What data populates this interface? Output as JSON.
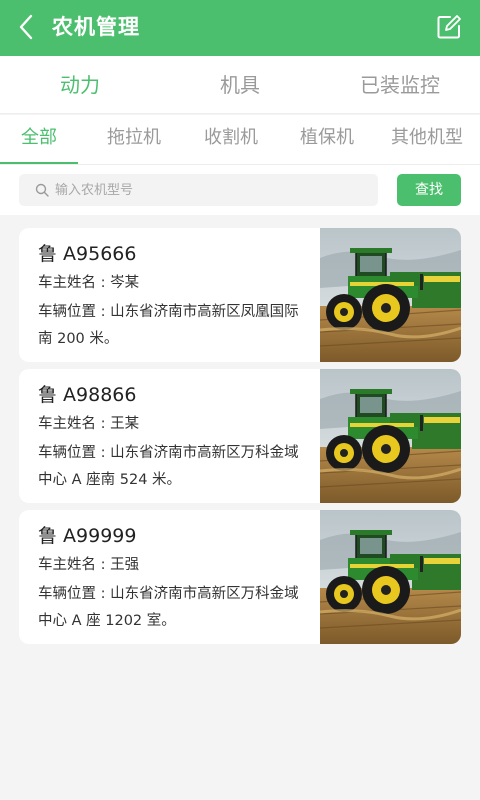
{
  "appbar": {
    "title": "农机管理",
    "back_icon": "chevron-left-icon",
    "edit_icon": "edit-icon"
  },
  "top_tabs": [
    "动力",
    "机具",
    "已装监控"
  ],
  "sub_tabs": [
    "全部",
    "拖拉机",
    "收割机",
    "植保机",
    "其他机型"
  ],
  "search": {
    "placeholder": "输入农机型号",
    "button_label": "查找"
  },
  "colors": {
    "accent": "#4cbf6e",
    "background": "#f4f4f4"
  },
  "machines": [
    {
      "plate": "鲁 A95666",
      "owner": "车主姓名 : 岑某",
      "location": "车辆位置 : 山东省济南市高新区凤凰国际南 200 米。",
      "image": "tractor-photo"
    },
    {
      "plate": "鲁 A98866",
      "owner": "车主姓名 : 王某",
      "location": "车辆位置 : 山东省济南市高新区万科金域中心 A 座南 524 米。",
      "image": "tractor-photo"
    },
    {
      "plate": "鲁 A99999",
      "owner": "车主姓名 : 王强",
      "location": "车辆位置 : 山东省济南市高新区万科金域中心 A 座 1202 室。",
      "image": "tractor-photo"
    }
  ]
}
